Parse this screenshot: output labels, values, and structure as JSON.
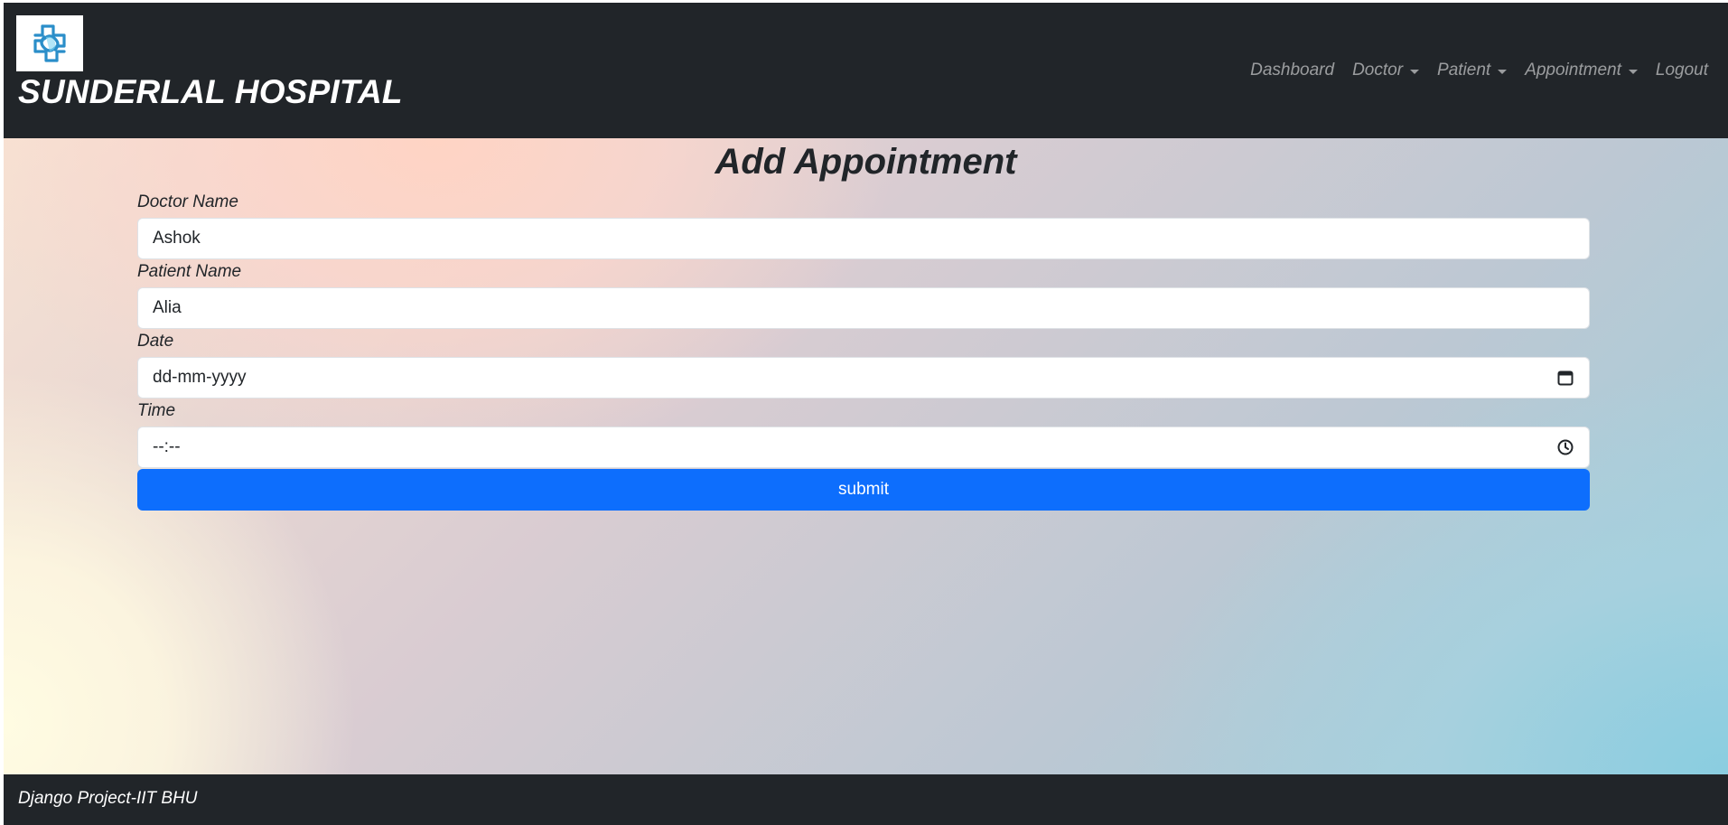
{
  "header": {
    "brand": "SUNDERLAL HOSPITAL",
    "logo_icon": "medical-cross-logo",
    "nav": [
      {
        "label": "Dashboard",
        "dropdown": false
      },
      {
        "label": "Doctor",
        "dropdown": true
      },
      {
        "label": "Patient",
        "dropdown": true
      },
      {
        "label": "Appointment",
        "dropdown": true
      },
      {
        "label": "Logout",
        "dropdown": false
      }
    ]
  },
  "form": {
    "title": "Add Appointment",
    "doctor": {
      "label": "Doctor Name",
      "value": "Ashok"
    },
    "patient": {
      "label": "Patient Name",
      "value": "Alia"
    },
    "date": {
      "label": "Date",
      "placeholder": "dd-mm-yyyy",
      "icon": "calendar-icon"
    },
    "time": {
      "label": "Time",
      "placeholder": "--:--",
      "icon": "clock-icon"
    },
    "submit_label": "submit"
  },
  "footer": {
    "text": "Django Project-IIT BHU"
  },
  "colors": {
    "navbar": "#212529",
    "primary": "#0d6efd",
    "logo_accent": "#2a8ec9"
  }
}
